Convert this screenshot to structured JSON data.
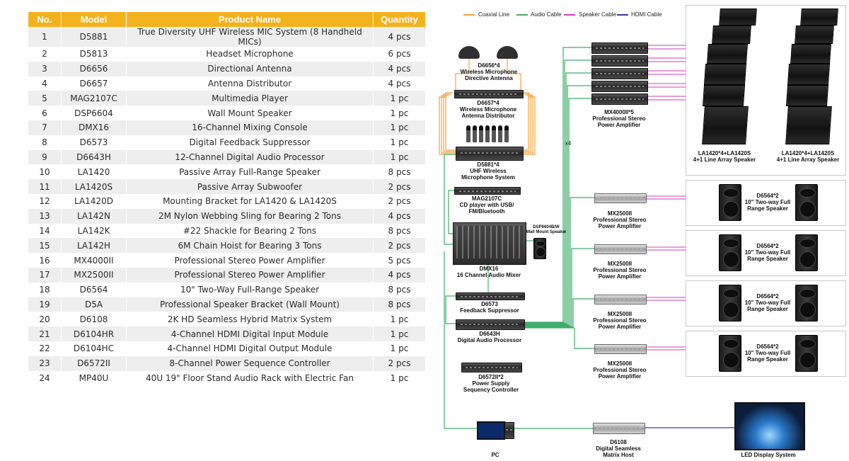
{
  "table": {
    "headers": {
      "no": "No.",
      "model": "Model",
      "name": "Product Name",
      "qty": "Quantity"
    },
    "rows": [
      {
        "no": "1",
        "model": "D5881",
        "name": "True Diversity UHF Wireless MIC System (8 Handheld MICs)",
        "qty": "4 pcs"
      },
      {
        "no": "2",
        "model": "D5813",
        "name": "Headset Microphone",
        "qty": "6 pcs"
      },
      {
        "no": "3",
        "model": "D6656",
        "name": "Directional Antenna",
        "qty": "4 pcs"
      },
      {
        "no": "4",
        "model": "D6657",
        "name": "Antenna Distributor",
        "qty": "4 pcs"
      },
      {
        "no": "5",
        "model": "MAG2107C",
        "name": "Multimedia Player",
        "qty": "1 pc"
      },
      {
        "no": "6",
        "model": "DSP6604",
        "name": "Wall Mount Speaker",
        "qty": "1 pc"
      },
      {
        "no": "7",
        "model": "DMX16",
        "name": "16-Channel Mixing Console",
        "qty": "1 pc"
      },
      {
        "no": "8",
        "model": "D6573",
        "name": "Digital Feedback Suppressor",
        "qty": "1 pc"
      },
      {
        "no": "9",
        "model": "D6643H",
        "name": "12-Channel Digital Audio Processor",
        "qty": "1 pc"
      },
      {
        "no": "10",
        "model": "LA1420",
        "name": "Passive Array Full-Range Speaker",
        "qty": "8 pcs"
      },
      {
        "no": "11",
        "model": "LA1420S",
        "name": "Passive Array Subwoofer",
        "qty": "2 pcs"
      },
      {
        "no": "12",
        "model": "LA1420D",
        "name": "Mounting Bracket for LA1420 & LA1420S",
        "qty": "2 pcs"
      },
      {
        "no": "13",
        "model": "LA142N",
        "name": "2M Nylon Webbing Sling for Bearing 2 Tons",
        "qty": "4 pcs"
      },
      {
        "no": "14",
        "model": "LA142K",
        "name": "#22 Shackle for Bearing 2 Tons",
        "qty": "8 pcs"
      },
      {
        "no": "15",
        "model": "LA142H",
        "name": "6M Chain Hoist for Bearing 3 Tons",
        "qty": "2 pcs"
      },
      {
        "no": "16",
        "model": "MX4000II",
        "name": "Professional Stereo Power Amplifier",
        "qty": "5 pcs"
      },
      {
        "no": "17",
        "model": "MX2500II",
        "name": "Professional Stereo Power Amplifier",
        "qty": "4 pcs"
      },
      {
        "no": "18",
        "model": "D6564",
        "name": "10\" Two-Way Full-Range Speaker",
        "qty": "8 pcs"
      },
      {
        "no": "19",
        "model": "D5A",
        "name": "Professional Speaker Bracket (Wall Mount)",
        "qty": "8 pcs"
      },
      {
        "no": "20",
        "model": "D6108",
        "name": "2K HD Seamless Hybrid Matrix System",
        "qty": "1 pc"
      },
      {
        "no": "21",
        "model": "D6104HR",
        "name": "4-Channel HDMI Digital Input Module",
        "qty": "1 pc"
      },
      {
        "no": "22",
        "model": "D6104HC",
        "name": "4-Channel HDMI Digital Output Module",
        "qty": "1 pc"
      },
      {
        "no": "23",
        "model": "D6572II",
        "name": "8-Channel Power Sequence Controller",
        "qty": "2 pcs"
      },
      {
        "no": "24",
        "model": "MP40U",
        "name": "40U 19\" Floor Stand Audio Rack with Electric Fan",
        "qty": "1 pc"
      }
    ]
  },
  "legend": {
    "coaxial": "Coaxial Line",
    "audio": "Audio Cable",
    "speaker": "Speaker Cable",
    "hdmi": "HDMI Cable"
  },
  "colors": {
    "header_bg": "#f3b21d",
    "coaxial": "#f0a53a",
    "audio": "#3fae6a",
    "speaker": "#d63ab8",
    "hdmi": "#3a3aa8"
  },
  "diagram": {
    "antenna_label": [
      "D6656*4",
      "Wireless Microphone",
      "Directive Antenna"
    ],
    "distributor_label": [
      "D6657*4",
      "Wireless Microphone",
      "Antenna Distributor"
    ],
    "uhf_label": [
      "D5881*4",
      "UHF Wireless",
      "Microphone System"
    ],
    "cd_label": [
      "MAG2107C",
      "CD player with USB/",
      "FM/Bluetooth"
    ],
    "wall_speaker_label": [
      "DSP6604B/W",
      "Wall Mount Speaker"
    ],
    "mixer_label": [
      "DMX16",
      "16 Channel Audio Mixer"
    ],
    "feedback_label": [
      "D6573",
      "Feedback Suppressor"
    ],
    "processor_label": [
      "D6643H",
      "Digital Audio Processor"
    ],
    "sequencer_label": [
      "D6572II*2",
      "Power Supply",
      "Sequency Controller"
    ],
    "pc_label": "PC",
    "matrix_label": [
      "D6108",
      "Digital Seamless",
      "Matrix Host"
    ],
    "led_label": "LED Display System",
    "x4_label": "x4",
    "mx4000_label": [
      "MX4000II*5",
      "Professional Stereo",
      "Power Amplifier"
    ],
    "mx2500_label": [
      "MX2500II",
      "Professional Stereo",
      "Power Amplifier"
    ],
    "line_array_label": [
      "LA1420*4+LA1420S",
      "4+1 Line Array Speaker"
    ],
    "d6564_label": [
      "D6564*2",
      "10\" Two-way Full",
      "Range Speaker"
    ]
  }
}
